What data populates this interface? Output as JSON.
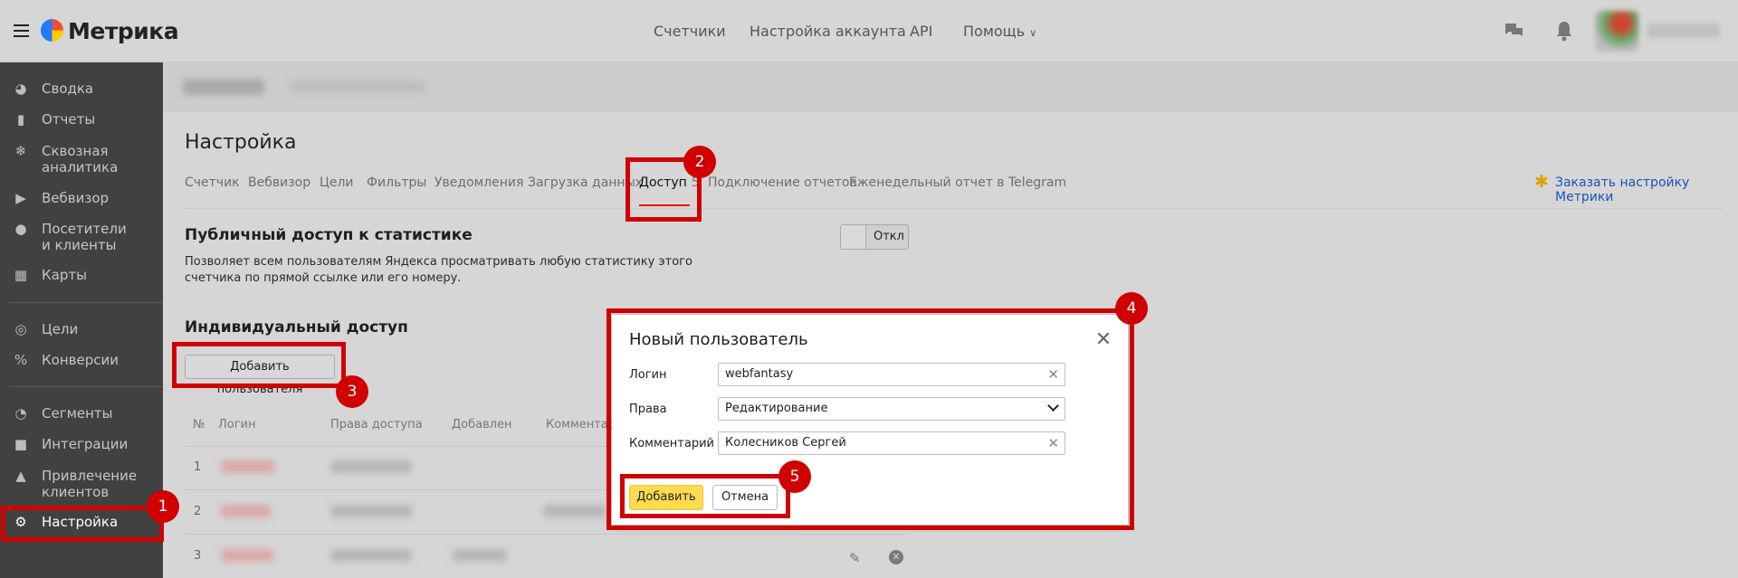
{
  "header": {
    "logo_text": "Метрика",
    "nav": [
      "Счетчики",
      "Настройка аккаунта",
      "API",
      "Помощь"
    ]
  },
  "sidebar": {
    "items": [
      {
        "label": "Сводка",
        "icon": "gauge-icon"
      },
      {
        "label": "Отчеты",
        "icon": "bar-chart-icon"
      },
      {
        "label": "Сквозная аналитика",
        "icon": "snowflake-icon"
      },
      {
        "label": "Вебвизор",
        "icon": "play-icon"
      },
      {
        "label": "Посетители и клиенты",
        "icon": "user-icon"
      },
      {
        "label": "Карты",
        "icon": "map-icon"
      },
      {
        "label": "Цели",
        "icon": "target-icon"
      },
      {
        "label": "Конверсии",
        "icon": "percent-icon"
      },
      {
        "label": "Сегменты",
        "icon": "pie-icon"
      },
      {
        "label": "Интеграции",
        "icon": "puzzle-icon"
      },
      {
        "label": "Привлечение клиентов",
        "icon": "flame-icon"
      },
      {
        "label": "Настройка",
        "icon": "gear-icon"
      }
    ]
  },
  "page": {
    "title": "Настройка",
    "tabs": [
      {
        "label": "Счетчик"
      },
      {
        "label": "Вебвизор"
      },
      {
        "label": "Цели"
      },
      {
        "label": "Фильтры"
      },
      {
        "label": "Уведомления"
      },
      {
        "label": "Загрузка данных"
      },
      {
        "label": "Доступ",
        "count": "5",
        "active": true
      },
      {
        "label": "Подключение отчетов"
      },
      {
        "label": "Еженедельный отчет в Telegram"
      }
    ],
    "order_link": "Заказать настройку Метрики"
  },
  "public_access": {
    "title": "Публичный доступ к статистике",
    "description": "Позволяет всем пользователям Яндекса просматривать любую статистику этого счетчика по прямой ссылке или его номеру.",
    "toggle_label": "Откл"
  },
  "individual_access": {
    "title": "Индивидуальный доступ",
    "add_button": "Добавить пользователя",
    "table": {
      "headers": [
        "№",
        "Логин",
        "Права доступа",
        "Добавлен",
        "Комментарий"
      ],
      "rows": [
        {
          "num": "1"
        },
        {
          "num": "2"
        },
        {
          "num": "3"
        }
      ]
    }
  },
  "modal": {
    "title": "Новый пользователь",
    "fields": {
      "login_label": "Логин",
      "login_value": "webfantasy",
      "rights_label": "Права",
      "rights_value": "Редактирование",
      "comment_label": "Комментарий",
      "comment_value": "Колесников Сергей"
    },
    "submit_label": "Добавить",
    "cancel_label": "Отмена"
  },
  "annotations": [
    "1",
    "2",
    "3",
    "4",
    "5"
  ],
  "colors": {
    "annotation": "#d10000",
    "primary_button": "#ffdb4d",
    "link": "#1a54b8",
    "sidebar_bg": "#414141"
  }
}
